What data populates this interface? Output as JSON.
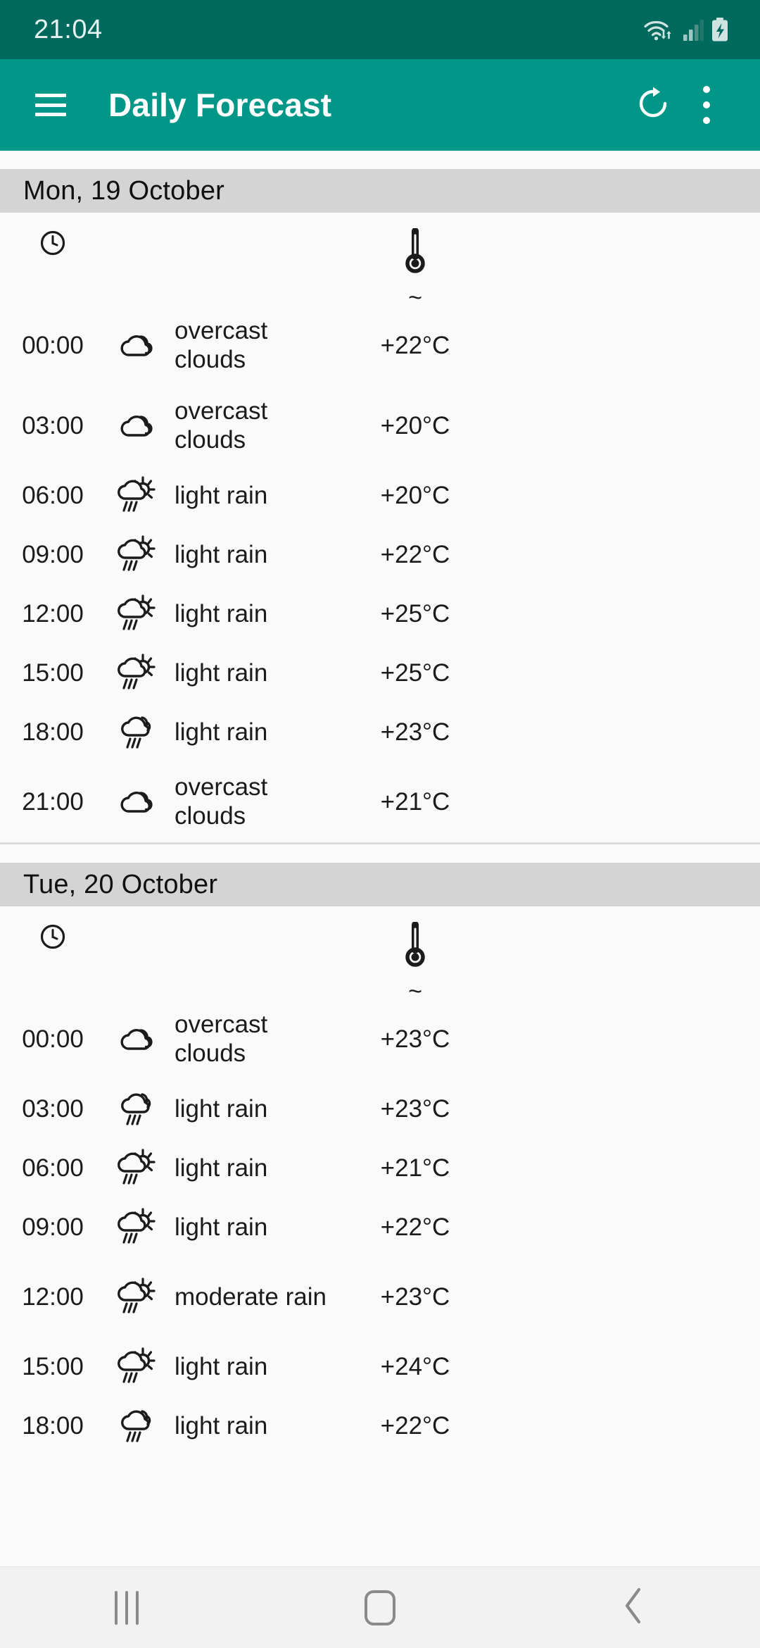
{
  "status_bar": {
    "time": "21:04",
    "icons": [
      "wifi-data-icon",
      "cellular-signal-icon",
      "battery-charging-icon"
    ]
  },
  "app_bar": {
    "menu_icon": "hamburger-menu-icon",
    "title": "Daily Forecast",
    "refresh_icon": "refresh-icon",
    "overflow_icon": "overflow-menu-icon"
  },
  "columns": {
    "time_icon": "clock-icon",
    "temp_icon": "thermometer-icon",
    "temp_approx": "~"
  },
  "days": [
    {
      "header": "Mon, 19 October",
      "rows": [
        {
          "time": "00:00",
          "icon": "overcast-clouds-icon",
          "desc": "overcast clouds",
          "temp": "+22°C"
        },
        {
          "time": "03:00",
          "icon": "overcast-clouds-icon",
          "desc": "overcast clouds",
          "temp": "+20°C"
        },
        {
          "time": "06:00",
          "icon": "day-rain-icon",
          "desc": "light rain",
          "temp": "+20°C"
        },
        {
          "time": "09:00",
          "icon": "day-rain-icon",
          "desc": "light rain",
          "temp": "+22°C"
        },
        {
          "time": "12:00",
          "icon": "day-rain-icon",
          "desc": "light rain",
          "temp": "+25°C"
        },
        {
          "time": "15:00",
          "icon": "day-rain-icon",
          "desc": "light rain",
          "temp": "+25°C"
        },
        {
          "time": "18:00",
          "icon": "night-rain-icon",
          "desc": "light rain",
          "temp": "+23°C"
        },
        {
          "time": "21:00",
          "icon": "overcast-clouds-icon",
          "desc": "overcast clouds",
          "temp": "+21°C"
        }
      ]
    },
    {
      "header": "Tue, 20 October",
      "rows": [
        {
          "time": "00:00",
          "icon": "overcast-clouds-icon",
          "desc": "overcast clouds",
          "temp": "+23°C"
        },
        {
          "time": "03:00",
          "icon": "night-rain-icon",
          "desc": "light rain",
          "temp": "+23°C"
        },
        {
          "time": "06:00",
          "icon": "day-rain-icon",
          "desc": "light rain",
          "temp": "+21°C"
        },
        {
          "time": "09:00",
          "icon": "day-rain-icon",
          "desc": "light rain",
          "temp": "+22°C"
        },
        {
          "time": "12:00",
          "icon": "day-rain-icon",
          "desc": "moderate rain",
          "temp": "+23°C"
        },
        {
          "time": "15:00",
          "icon": "day-rain-icon",
          "desc": "light rain",
          "temp": "+24°C"
        },
        {
          "time": "18:00",
          "icon": "night-rain-icon",
          "desc": "light rain",
          "temp": "+22°C"
        }
      ]
    }
  ],
  "nav_bar": {
    "recents_icon": "recents-icon",
    "home_icon": "home-icon",
    "back_icon": "back-icon"
  },
  "colors": {
    "status_bar": "#00695e",
    "app_bar": "#009688",
    "day_header": "#d4d4d4",
    "page_bg": "#fafafa",
    "nav_bar": "#f2f2f2"
  }
}
